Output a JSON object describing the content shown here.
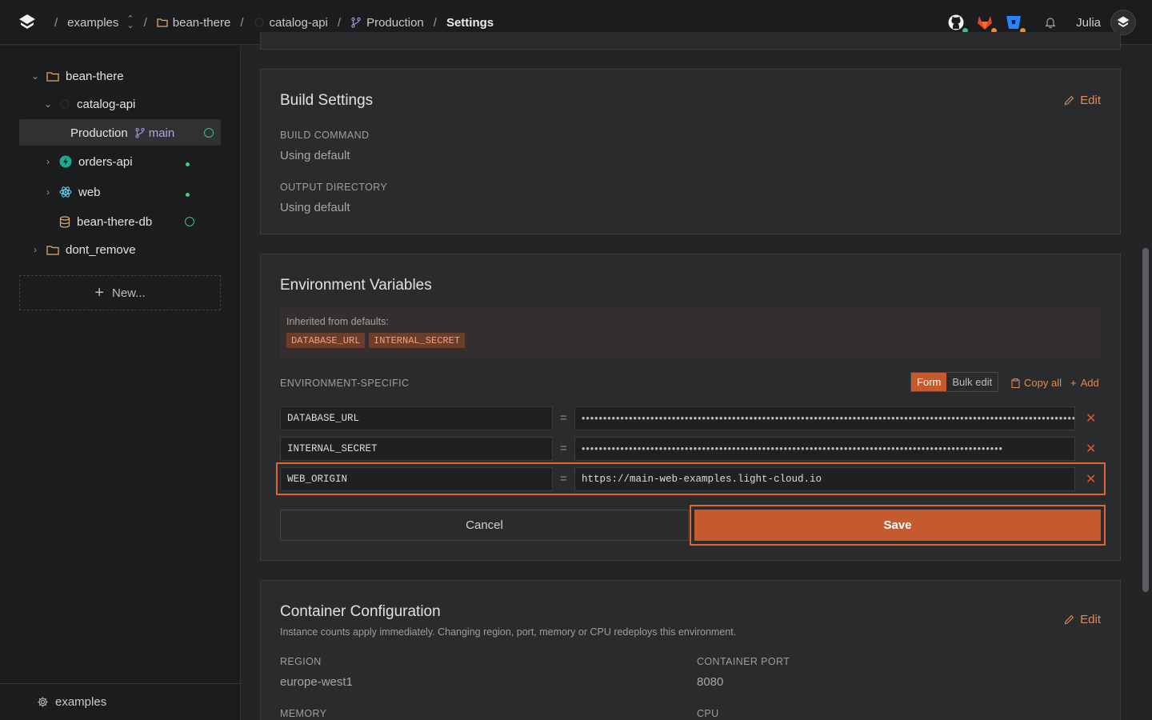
{
  "breadcrumbs": {
    "org": "examples",
    "project": "bean-there",
    "service": "catalog-api",
    "environment": "Production",
    "page": "Settings",
    "separator": "/"
  },
  "topbar": {
    "tools": [
      {
        "icon": "github-icon",
        "status_color": "#3fbf7a"
      },
      {
        "icon": "gitlab-icon",
        "status_color": "#f08a24"
      },
      {
        "icon": "bitbucket-icon",
        "status_color": "#f08a24"
      }
    ],
    "notifications_icon": "bell-icon",
    "user_name": "Julia"
  },
  "sidebar": {
    "tree": [
      {
        "label": "bean-there",
        "icon": "folder-icon",
        "expanded": true
      },
      {
        "label": "catalog-api",
        "icon": "service-icon",
        "expanded": true
      },
      {
        "label": "Production",
        "branch": "main",
        "status": "ok",
        "selected": true
      },
      {
        "label": "orders-api",
        "icon": "bolt-icon",
        "status": "running"
      },
      {
        "label": "web",
        "icon": "react-icon",
        "status": "running"
      },
      {
        "label": "bean-there-db",
        "icon": "database-icon",
        "status": "ok"
      },
      {
        "label": "dont_remove",
        "icon": "folder-icon",
        "expanded": false
      }
    ],
    "new_button": "New...",
    "footer": "examples"
  },
  "build_settings": {
    "title": "Build Settings",
    "edit": "Edit",
    "build_command_label": "BUILD COMMAND",
    "build_command_value": "Using default",
    "output_directory_label": "OUTPUT DIRECTORY",
    "output_directory_value": "Using default"
  },
  "env_vars": {
    "title": "Environment Variables",
    "inherited_label": "Inherited from defaults:",
    "inherited": [
      "DATABASE_URL",
      "INTERNAL_SECRET"
    ],
    "section_label": "ENVIRONMENT-SPECIFIC",
    "mode_form": "Form",
    "mode_bulk": "Bulk edit",
    "active_mode": "Form",
    "copy_all": "Copy all",
    "add": "Add",
    "rows": [
      {
        "key": "DATABASE_URL",
        "value": "••••••••••••••••••••••••••••••••••••••••••••••••••••••••••••••••••••••••••••••••••••••••••••••••••••••••••••••••••••••••••••",
        "masked": true
      },
      {
        "key": "INTERNAL_SECRET",
        "value": "••••••••••••••••••••••••••••••••••••••••••••••••••••••••••••••••••••••••••••••••••••••••••••••••••",
        "masked": true
      },
      {
        "key": "WEB_ORIGIN",
        "value": "https://main-web-examples.light-cloud.io",
        "masked": false
      }
    ],
    "equals": "=",
    "remove": "✕",
    "cancel": "Cancel",
    "save": "Save"
  },
  "container": {
    "title": "Container Configuration",
    "edit": "Edit",
    "subtitle": "Instance counts apply immediately. Changing region, port, memory or CPU redeploys this environment.",
    "region_label": "REGION",
    "region_value": "europe-west1",
    "port_label": "CONTAINER PORT",
    "port_value": "8080",
    "memory_label": "MEMORY",
    "cpu_label": "CPU"
  },
  "colors": {
    "accent": "#c65a2f",
    "link": "#e28a5a",
    "ok": "#3fbf7a",
    "danger": "#e0553f"
  }
}
